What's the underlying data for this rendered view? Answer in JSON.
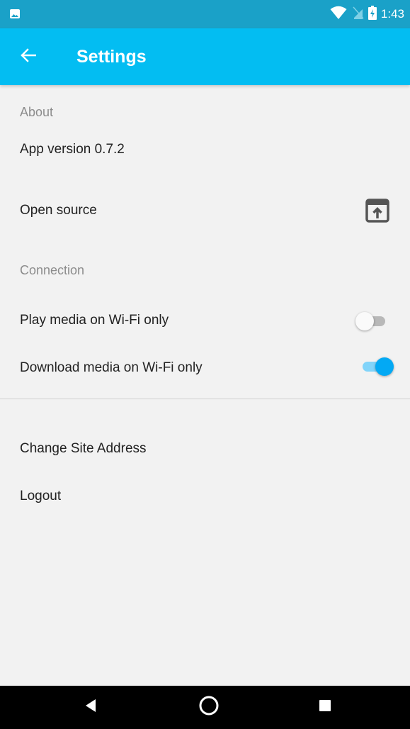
{
  "status_bar": {
    "time": "1:43",
    "icons": [
      "gallery-icon",
      "wifi-icon",
      "no-sim-icon",
      "battery-icon"
    ]
  },
  "app_bar": {
    "title": "Settings",
    "back_icon": "arrow-left-icon",
    "background_color": "#03bdf2"
  },
  "about": {
    "header": "About",
    "app_version": "App version 0.7.2",
    "open_source_label": "Open source",
    "open_source_icon": "open-in-browser-icon"
  },
  "connection": {
    "header": "Connection",
    "play_wifi_label": "Play media on Wi-Fi only",
    "play_wifi_enabled": false,
    "download_wifi_label": "Download media on Wi-Fi only",
    "download_wifi_enabled": true
  },
  "account": {
    "change_site_label": "Change Site Address",
    "logout_label": "Logout"
  },
  "nav_bar": {
    "buttons": [
      "back-triangle-icon",
      "home-circle-icon",
      "recents-square-icon"
    ]
  },
  "colors": {
    "accent": "#03bdf2",
    "status_bar": "#1aa1c8",
    "toggle_on_thumb": "#03a9f4",
    "toggle_on_track": "#81d4fa",
    "toggle_off_thumb": "#fafafa",
    "toggle_off_track": "#b8b8b8"
  }
}
